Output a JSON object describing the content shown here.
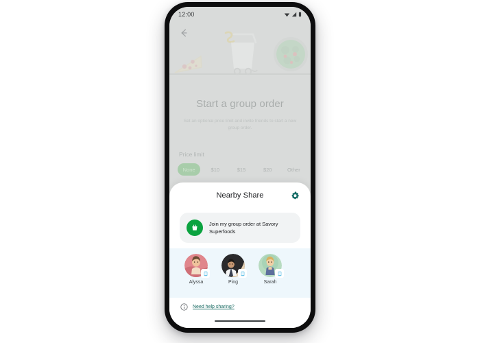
{
  "device": {
    "status_bar": {
      "time": "12:00",
      "icons": [
        "wifi-icon",
        "signal-icon",
        "battery-icon"
      ]
    },
    "home_indicator": "home-indicator"
  },
  "app_screen": {
    "back_icon": "back-arrow-icon",
    "illustration": {
      "items": [
        "pizza-slice-illustration",
        "shopping-cart-illustration",
        "salad-bowl-illustration"
      ]
    },
    "title": "Start a group order",
    "subtitle": "Set an optional price limit and invite friends to start a new group order.",
    "price_limit": {
      "label": "Price limit",
      "options": [
        {
          "label": "None",
          "selected": true
        },
        {
          "label": "$10",
          "selected": false
        },
        {
          "label": "$15",
          "selected": false
        },
        {
          "label": "$20",
          "selected": false
        },
        {
          "label": "Other",
          "selected": false
        }
      ]
    }
  },
  "nearby_share_sheet": {
    "title": "Nearby Share",
    "settings_icon": "gear-icon",
    "share_preview": {
      "app_icon": "shopping-basket-icon",
      "app_icon_color": "#0ba340",
      "text": "Join my group order at Savory Superfoods"
    },
    "contacts": [
      {
        "name": "Alyssa",
        "badge_icon": "phone-device-icon"
      },
      {
        "name": "Ping",
        "badge_icon": "phone-device-icon"
      },
      {
        "name": "Sarah",
        "badge_icon": "phone-device-icon"
      }
    ],
    "help": {
      "icon": "info-icon",
      "link_text": "Need help sharing?",
      "link_color": "#1a6b63"
    }
  }
}
